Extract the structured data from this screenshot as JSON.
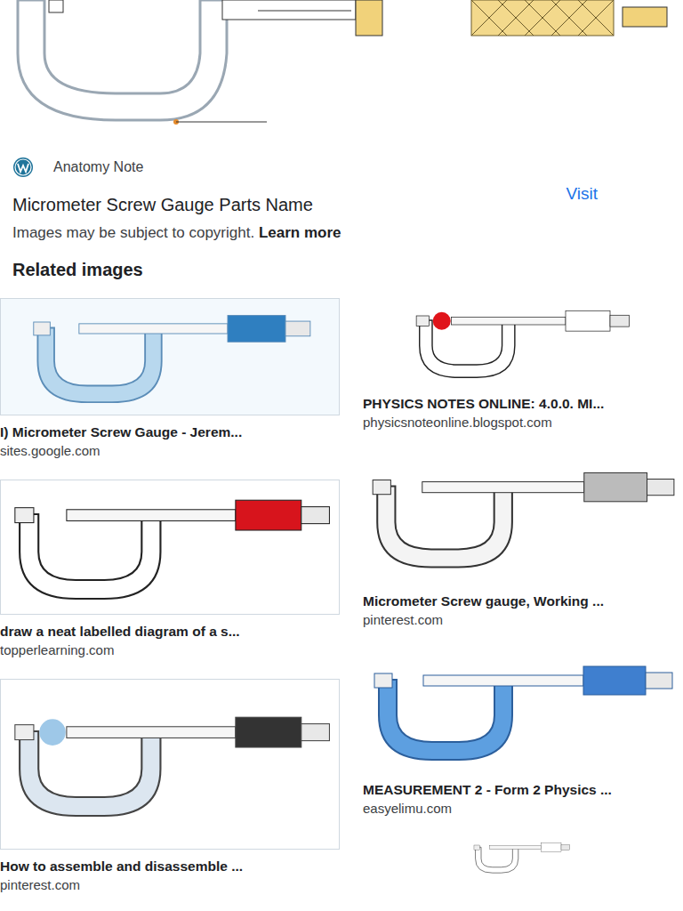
{
  "result": {
    "source": "Anatomy Note",
    "title": "Micrometer Screw Gauge Parts Name",
    "visit": "Visit",
    "copyright": "Images may be subject to copyright.",
    "learn_more": "Learn more"
  },
  "related": {
    "heading": "Related images",
    "items": [
      {
        "title": "I) Micrometer Screw Gauge - Jerem...",
        "source": "sites.google.com"
      },
      {
        "title": "PHYSICS NOTES ONLINE: 4.0.0. MI...",
        "source": "physicsnoteonline.blogspot.com"
      },
      {
        "title": "draw a neat labelled diagram of a s...",
        "source": "topperlearning.com"
      },
      {
        "title": "Micrometer Screw gauge, Working ...",
        "source": "pinterest.com"
      },
      {
        "title": "How to assemble and disassemble ...",
        "source": "pinterest.com"
      },
      {
        "title": "MEASUREMENT 2 - Form 2 Physics ...",
        "source": "easyelimu.com"
      }
    ]
  }
}
